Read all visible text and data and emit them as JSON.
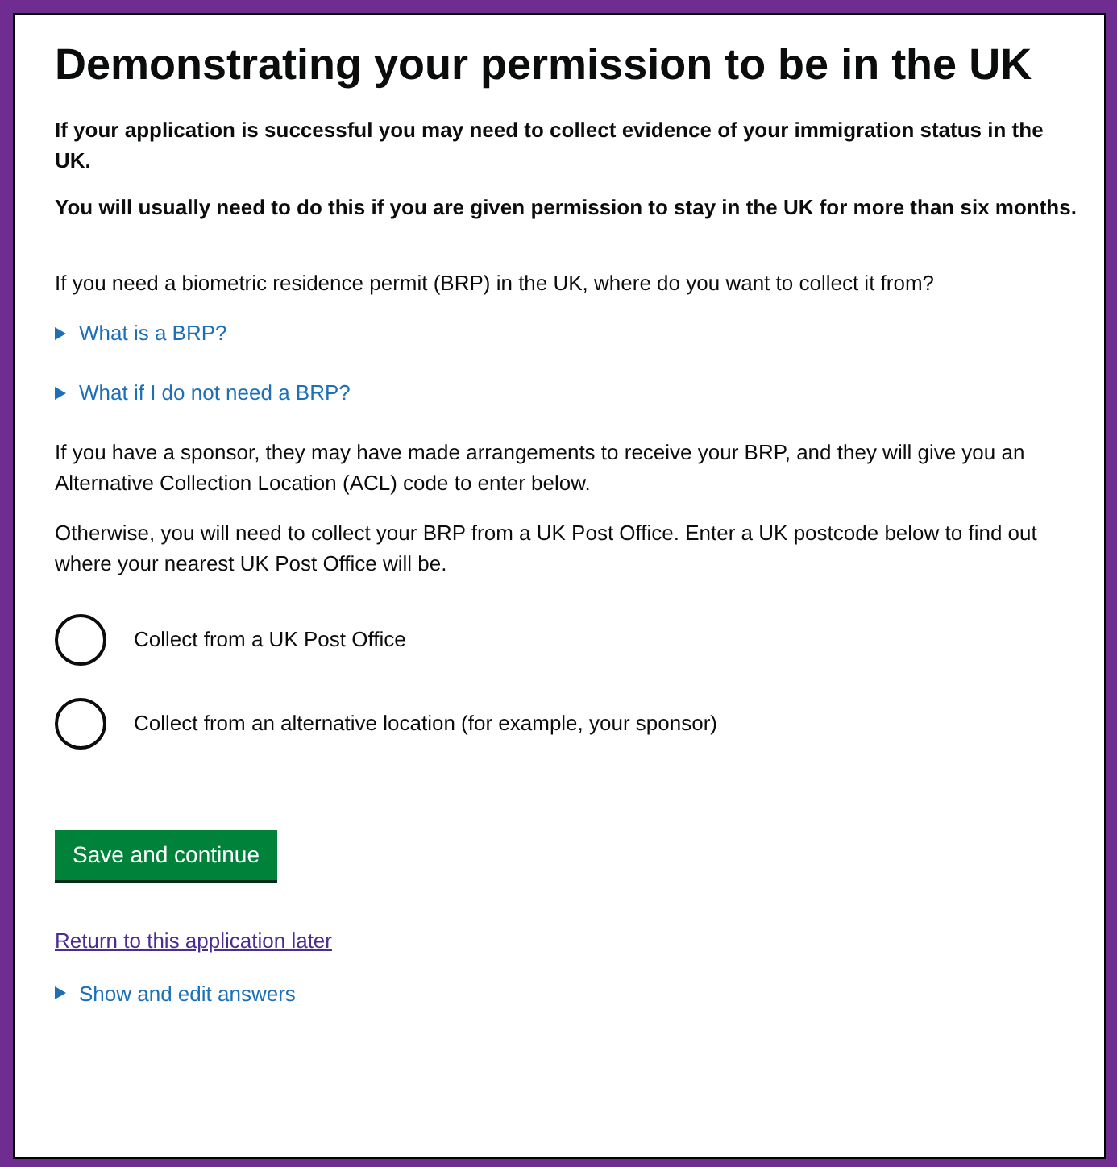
{
  "heading": "Demonstrating your permission to be in the UK",
  "intro": [
    "If your application is successful you may need to collect evidence of your immigration status in the UK.",
    "You will usually need to do this if you are given permission to stay in the UK for more than six months."
  ],
  "question": "If you need a biometric residence permit (BRP) in the UK, where do you want to collect it from?",
  "details": [
    {
      "label": "What is a BRP?",
      "expanded": false
    },
    {
      "label": "What if I do not need a BRP?",
      "expanded": false
    }
  ],
  "paragraphs": [
    "If you have a sponsor, they may have made arrangements to receive your BRP, and they will give you an Alternative Collection Location (ACL) code to enter below.",
    "Otherwise, you will need to collect your BRP from a UK Post Office. Enter a UK postcode below to find out where your nearest UK Post Office will be."
  ],
  "options": [
    {
      "label": "Collect from a UK Post Office",
      "selected": false
    },
    {
      "label": "Collect from an alternative location (for example, your sponsor)",
      "selected": false
    }
  ],
  "primary_button": "Save and continue",
  "return_link": "Return to this application later",
  "bottom_details": {
    "label": "Show and edit answers",
    "expanded": false
  }
}
